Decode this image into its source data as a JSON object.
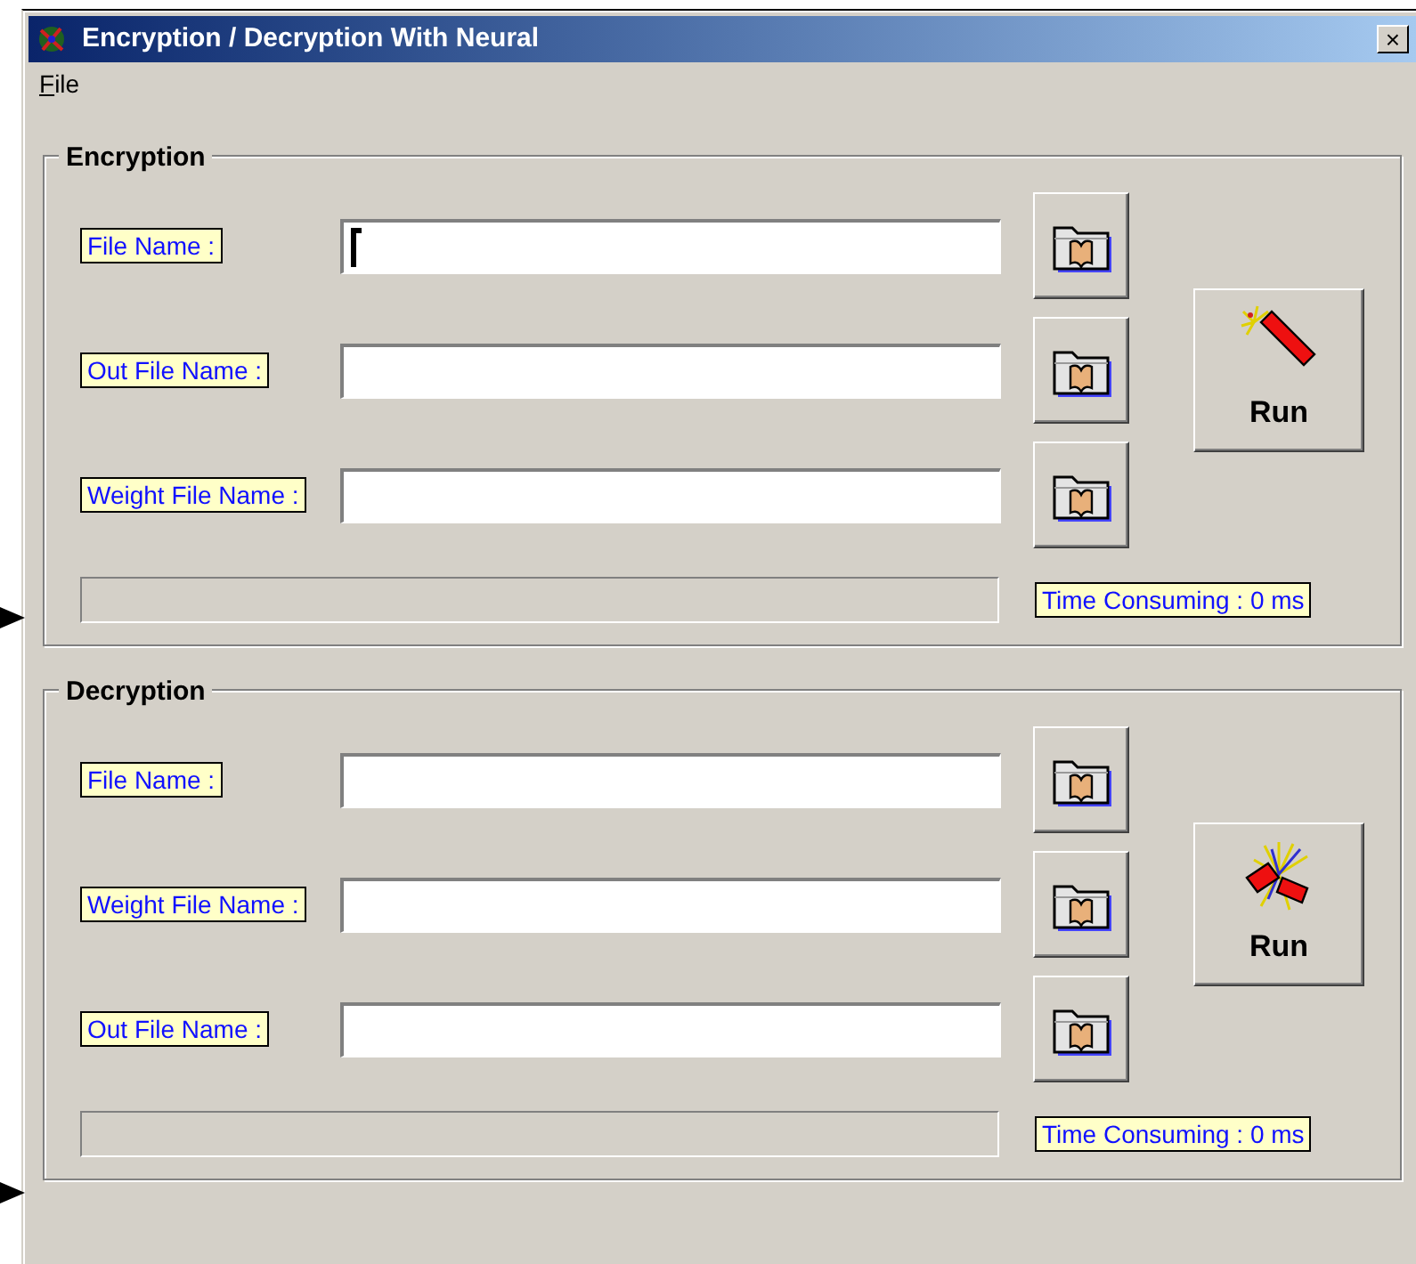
{
  "window": {
    "title": "Encryption / Decryption With Neural",
    "close": "×"
  },
  "menu": [
    {
      "label": "File"
    }
  ],
  "groups": [
    {
      "kind": "encrypt",
      "title": "Encryption",
      "fields": [
        {
          "label": "File Name :",
          "focused": true
        },
        {
          "label": "Out File Name :",
          "focused": false
        },
        {
          "label": "Weight File Name :",
          "focused": false
        }
      ],
      "run": "Run",
      "progress": {
        "level": 0
      },
      "time": "Time Consuming : 0 ms"
    },
    {
      "kind": "decrypt",
      "title": "Decryption",
      "fields": [
        {
          "label": "File Name :",
          "focused": false
        },
        {
          "label": "Weight File Name :",
          "focused": false
        },
        {
          "label": "Out File Name :",
          "focused": false
        }
      ],
      "run": "Run",
      "progress": {
        "level": 0
      },
      "time": "Time Consuming : 0 ms"
    }
  ]
}
